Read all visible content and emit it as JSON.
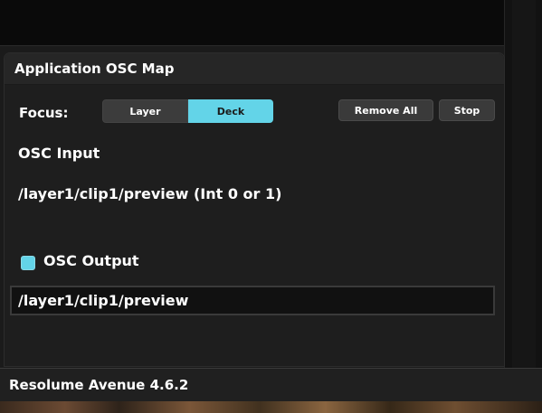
{
  "app": {
    "name": "Resolume Avenue 4.6.2"
  },
  "panel": {
    "title": "Application OSC Map"
  },
  "focus": {
    "label": "Focus:",
    "options": [
      "Layer",
      "Deck"
    ],
    "selected": "Deck"
  },
  "buttons": {
    "remove_all": "Remove All",
    "stop": "Stop"
  },
  "osc_input": {
    "title": "OSC Input",
    "value": "/layer1/clip1/preview (Int 0 or 1)"
  },
  "osc_output": {
    "label": "OSC Output",
    "enabled": true,
    "value": "/layer1/clip1/preview"
  },
  "colors": {
    "accent": "#63d4e8",
    "panel": "#1e1e1e",
    "field": "#111111"
  }
}
